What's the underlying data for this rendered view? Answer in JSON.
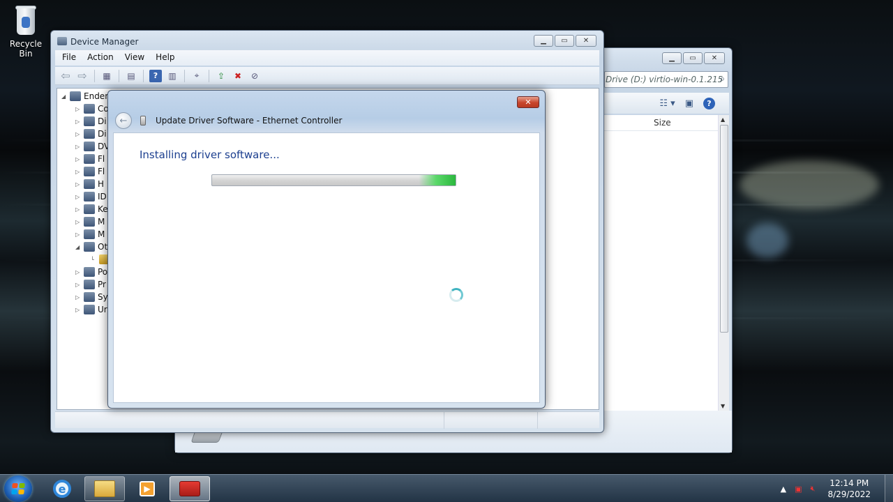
{
  "desktop": {
    "recycle_bin_label": "Recycle Bin"
  },
  "explorer": {
    "address_text": "Drive (D:) virtio-win-0.1.215",
    "size_header": "Size"
  },
  "device_manager": {
    "title": "Device Manager",
    "menus": [
      "File",
      "Action",
      "View",
      "Help"
    ],
    "tree": {
      "root": "Ender",
      "items": [
        {
          "label": "Co",
          "expanded": false
        },
        {
          "label": "Di",
          "expanded": false
        },
        {
          "label": "Di",
          "expanded": false
        },
        {
          "label": "DV",
          "expanded": false
        },
        {
          "label": "Fl",
          "expanded": false
        },
        {
          "label": "Fl",
          "expanded": false
        },
        {
          "label": "H",
          "expanded": false
        },
        {
          "label": "ID",
          "expanded": false
        },
        {
          "label": "Ke",
          "expanded": false
        },
        {
          "label": "M",
          "expanded": false
        },
        {
          "label": "M",
          "expanded": false
        },
        {
          "label": "Ot",
          "expanded": true
        },
        {
          "label": "",
          "expanded": false
        },
        {
          "label": "Po",
          "expanded": false
        },
        {
          "label": "Pr",
          "expanded": false
        },
        {
          "label": "Sy",
          "expanded": false
        },
        {
          "label": "Ur",
          "expanded": false
        }
      ]
    }
  },
  "dialog": {
    "title": "Update Driver Software - Ethernet Controller",
    "heading": "Installing driver software...",
    "close_symbol": "✕",
    "progress_fraction": 1.0
  },
  "taskbar": {
    "time": "12:14 PM",
    "date": "8/29/2022",
    "start_colors": [
      "#f25022",
      "#7fba00",
      "#00a4ef",
      "#ffb900"
    ]
  }
}
